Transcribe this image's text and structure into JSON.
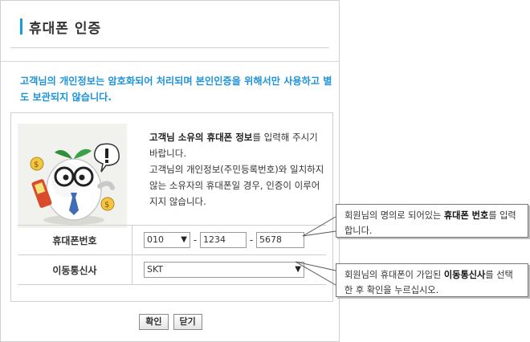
{
  "window": {
    "title": "휴대폰 인증",
    "notice": "고객님의 개인정보는 암호화되어 처리되며 본인인증을 위해서만 사용하고 별도 보관되지 않습니다."
  },
  "intro": {
    "bold_part": "고객님 소유의 휴대폰 정보",
    "line1_rest": "를 입력해 주시기 바랍니다.",
    "line2": "고객님의 개인정보(주민등록번호)와 일치하지 않는 소유자의 휴대폰일 경우, 인증이 이루어지지 않습니다."
  },
  "form": {
    "phone_label": "휴대폰번호",
    "prefix_value": "010",
    "middle_value": "1234",
    "last_value": "5678",
    "dash": "-",
    "carrier_label": "이동통신사",
    "carrier_value": "SKT"
  },
  "buttons": {
    "confirm": "확인",
    "close": "닫기"
  },
  "callouts": {
    "phone_pre": "회원님의 명의로 되어있는 ",
    "phone_bold": "휴대폰 번호",
    "phone_post": "를 입력합니다.",
    "carrier_pre": "회원님의 휴대폰이 가입된 ",
    "carrier_bold": "이동통신사",
    "carrier_post": "를 선택한 후 확인을 누르십시오."
  },
  "colors": {
    "accent": "#1a9ad6",
    "notice": "#1e93d8"
  },
  "icons": {
    "select_arrow": "▼"
  }
}
